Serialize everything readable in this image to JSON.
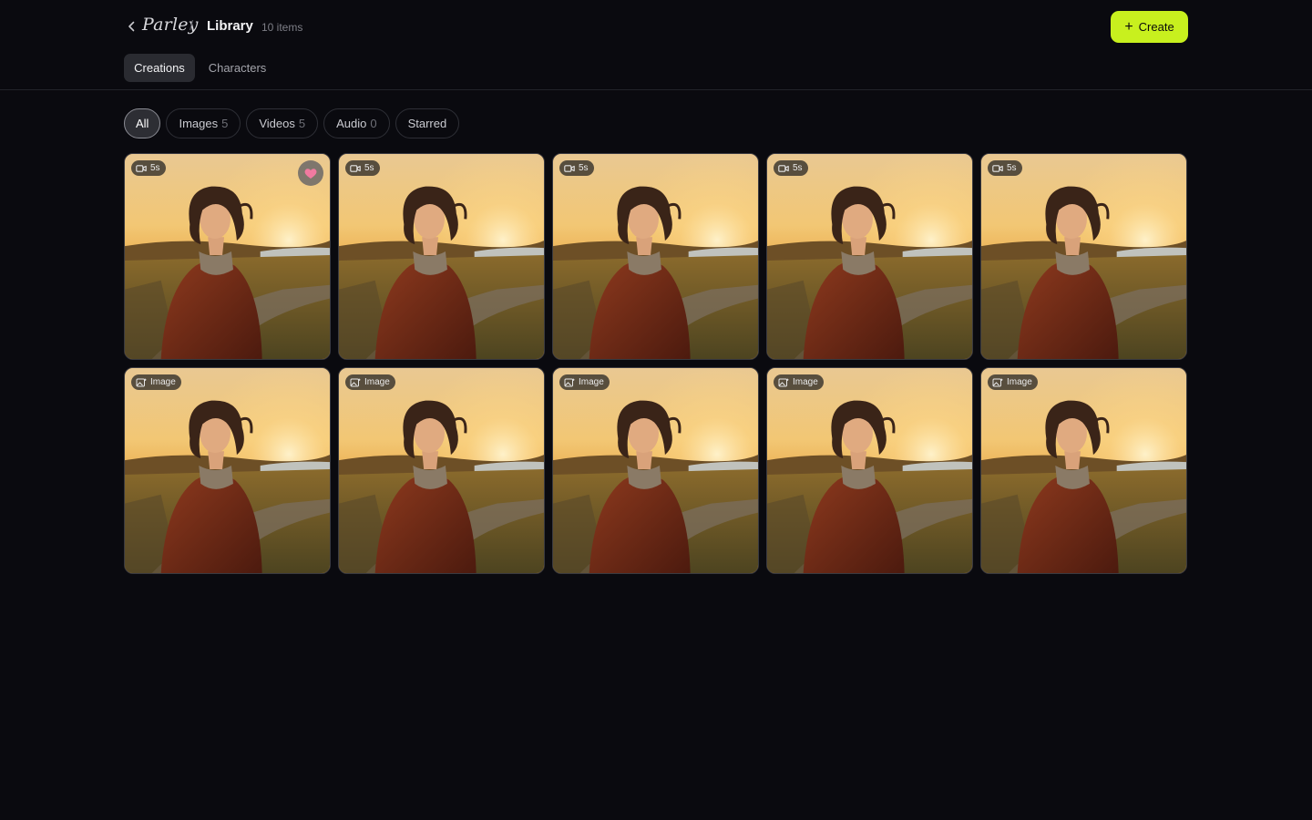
{
  "app": {
    "logo": "Parley"
  },
  "header": {
    "separator": "/",
    "title": "Library",
    "count": "10 items",
    "create_label": "Create"
  },
  "tabs": [
    {
      "label": "Creations",
      "active": true
    },
    {
      "label": "Characters",
      "active": false
    }
  ],
  "filters": [
    {
      "label": "All",
      "count": "",
      "active": true
    },
    {
      "label": "Images",
      "count": "5",
      "active": false
    },
    {
      "label": "Videos",
      "count": "5",
      "active": false
    },
    {
      "label": "Audio",
      "count": "0",
      "active": false
    },
    {
      "label": "Starred",
      "count": "",
      "active": false
    }
  ],
  "items": [
    {
      "type": "video",
      "badge": "5s",
      "icon": "video-camera-icon",
      "starred": true
    },
    {
      "type": "video",
      "badge": "5s",
      "icon": "video-camera-icon",
      "starred": false
    },
    {
      "type": "video",
      "badge": "5s",
      "icon": "video-camera-icon",
      "starred": false
    },
    {
      "type": "video",
      "badge": "5s",
      "icon": "video-camera-icon",
      "starred": false
    },
    {
      "type": "video",
      "badge": "5s",
      "icon": "video-camera-icon",
      "starred": false
    },
    {
      "type": "image",
      "badge": "Image",
      "icon": "image-sparkle-icon",
      "starred": false
    },
    {
      "type": "image",
      "badge": "Image",
      "icon": "image-sparkle-icon",
      "starred": false
    },
    {
      "type": "image",
      "badge": "Image",
      "icon": "image-sparkle-icon",
      "starred": false
    },
    {
      "type": "image",
      "badge": "Image",
      "icon": "image-sparkle-icon",
      "starred": false
    },
    {
      "type": "image",
      "badge": "Image",
      "icon": "image-sparkle-icon",
      "starred": false
    }
  ],
  "colors": {
    "accent": "#c8f01e",
    "background": "#0a0a0f",
    "heart": "#f07aa0"
  }
}
